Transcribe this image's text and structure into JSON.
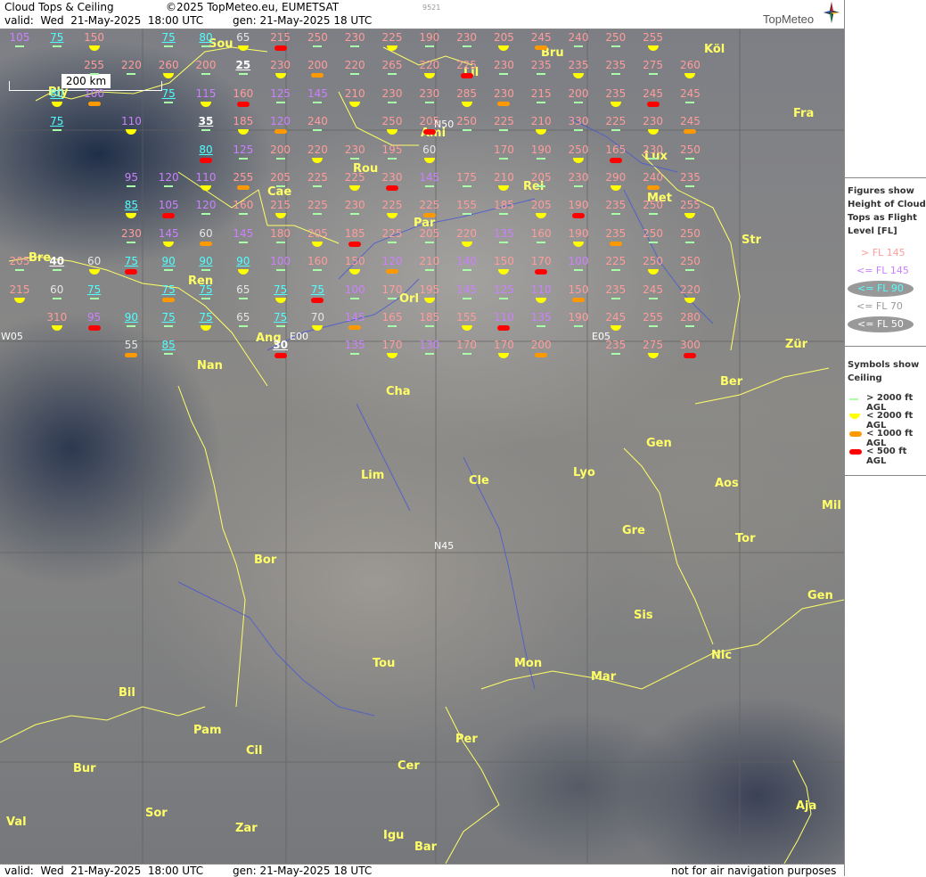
{
  "header": {
    "product": "Cloud Tops & Ceiling",
    "copyright": "©2025 TopMeteo.eu, EUMETSAT",
    "id": "9521",
    "valid": "valid:  Wed  21-May-2025  18:00 UTC",
    "gen": "gen: 21-May-2025 18 UTC",
    "logo": "TopMeteo"
  },
  "footer": {
    "valid": "valid:  Wed  21-May-2025  18:00 UTC",
    "gen": "gen: 21-May-2025 18 UTC",
    "disclaimer": "not for air navigation purposes"
  },
  "scale": {
    "label": "200 km"
  },
  "legend": {
    "title": "Figures show Height of Cloud Tops as Flight Level  [FL]",
    "items": [
      "> FL 145",
      "<= FL 145",
      "<= FL 90",
      "<= FL 70",
      "<= FL 50"
    ],
    "symbols_title": "Symbols show Ceiling",
    "symbols": [
      "> 2000 ft AGL",
      "< 2000 ft AGL",
      "< 1000 ft AGL",
      "< 500 ft AGL"
    ],
    "colors": {
      "gt145": "#ff9c9c",
      "le145": "#cc80ff",
      "le90": "#50ffff",
      "le70": "#e6e6e6",
      "le50": "#ffffff",
      "sym_gt2000": "#a8ffa8",
      "sym_lt2000": "#ffff00",
      "sym_lt1000": "#ff9900",
      "sym_lt500": "#ff0000"
    }
  },
  "coords": [
    "N50",
    "E00",
    "E05",
    "W05",
    "N45"
  ],
  "cities": [
    "Sou",
    "Ply",
    "Lil",
    "Bru",
    "Köl",
    "Ami",
    "Fra",
    "Lux",
    "Rou",
    "Cae",
    "Rei",
    "Met",
    "Par",
    "Str",
    "Bre",
    "Ren",
    "Orl",
    "Ang",
    "Nan",
    "Zür",
    "Ber",
    "Cha",
    "Gen",
    "Lim",
    "Cle",
    "Lyo",
    "Aos",
    "Mil",
    "Gre",
    "Tor",
    "Bor",
    "Gen",
    "Sis",
    "Nic",
    "Tou",
    "Mon",
    "Mar",
    "Bil",
    "Pam",
    "Cil",
    "Per",
    "Cer",
    "Bur",
    "Sor",
    "Zar",
    "Aja",
    "Val",
    "Igu",
    "Bar"
  ],
  "rows": [
    [
      105,
      75,
      150,
      0,
      75,
      80,
      65,
      215,
      250,
      230,
      225,
      190,
      230,
      205,
      245,
      240,
      250,
      255,
      0
    ],
    [
      0,
      0,
      255,
      220,
      260,
      200,
      25,
      230,
      200,
      220,
      265,
      220,
      225,
      230,
      235,
      235,
      235,
      275,
      260
    ],
    [
      0,
      80,
      100,
      0,
      75,
      115,
      160,
      125,
      145,
      210,
      230,
      230,
      285,
      230,
      215,
      200,
      235,
      245,
      245
    ],
    [
      0,
      75,
      0,
      110,
      0,
      35,
      185,
      120,
      240,
      0,
      250,
      205,
      250,
      225,
      210,
      330,
      225,
      230,
      245
    ],
    [
      0,
      0,
      0,
      0,
      0,
      80,
      125,
      200,
      220,
      230,
      195,
      60,
      0,
      170,
      190,
      250,
      165,
      230,
      250
    ],
    [
      0,
      0,
      0,
      95,
      120,
      110,
      255,
      205,
      225,
      225,
      230,
      145,
      175,
      210,
      205,
      230,
      290,
      240,
      235
    ],
    [
      0,
      0,
      0,
      85,
      105,
      120,
      160,
      215,
      225,
      230,
      225,
      225,
      155,
      185,
      205,
      190,
      235,
      250,
      255
    ],
    [
      0,
      0,
      0,
      230,
      145,
      60,
      145,
      180,
      205,
      185,
      225,
      205,
      220,
      135,
      160,
      190,
      235,
      250,
      250
    ],
    [
      205,
      40,
      60,
      75,
      90,
      90,
      90,
      100,
      160,
      150,
      120,
      210,
      140,
      150,
      170,
      100,
      225,
      250,
      250
    ],
    [
      215,
      60,
      75,
      0,
      75,
      75,
      65,
      75,
      75,
      100,
      170,
      195,
      145,
      125,
      110,
      150,
      235,
      245,
      220
    ],
    [
      0,
      310,
      95,
      90,
      75,
      75,
      65,
      75,
      70,
      145,
      165,
      185,
      155,
      110,
      135,
      190,
      245,
      255,
      280
    ],
    [
      0,
      0,
      0,
      55,
      85,
      0,
      0,
      30,
      0,
      135,
      170,
      130,
      170,
      170,
      200,
      0,
      235,
      275,
      300
    ]
  ]
}
